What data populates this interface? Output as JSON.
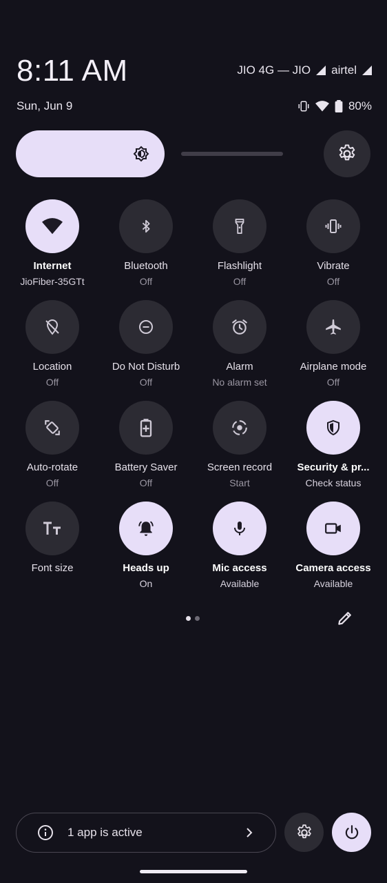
{
  "status": {
    "time": "8:11 AM",
    "carrier1": "JIO 4G — JIO",
    "carrier2": "airtel",
    "date": "Sun, Jun 9",
    "battery": "80%"
  },
  "brightness": {
    "level": 0.71
  },
  "colors": {
    "accent": "#e7def8",
    "tile_off": "#2c2b33",
    "background": "#13121b"
  },
  "tiles": [
    {
      "label": "Internet",
      "sub": "JioFiber-35GTt",
      "on": true,
      "icon": "wifi-icon"
    },
    {
      "label": "Bluetooth",
      "sub": "Off",
      "on": false,
      "icon": "bluetooth-icon"
    },
    {
      "label": "Flashlight",
      "sub": "Off",
      "on": false,
      "icon": "flashlight-icon"
    },
    {
      "label": "Vibrate",
      "sub": "Off",
      "on": false,
      "icon": "vibrate-icon"
    },
    {
      "label": "Location",
      "sub": "Off",
      "on": false,
      "icon": "location-off-icon"
    },
    {
      "label": "Do Not Disturb",
      "sub": "Off",
      "on": false,
      "icon": "do-not-disturb-icon"
    },
    {
      "label": "Alarm",
      "sub": "No alarm set",
      "on": false,
      "icon": "alarm-icon"
    },
    {
      "label": "Airplane mode",
      "sub": "Off",
      "on": false,
      "icon": "airplane-icon"
    },
    {
      "label": "Auto-rotate",
      "sub": "Off",
      "on": false,
      "icon": "auto-rotate-icon"
    },
    {
      "label": "Battery Saver",
      "sub": "Off",
      "on": false,
      "icon": "battery-saver-icon"
    },
    {
      "label": "Screen record",
      "sub": "Start",
      "on": false,
      "icon": "screen-record-icon"
    },
    {
      "label": "Security & pr...",
      "sub": "Check status",
      "on": true,
      "icon": "shield-icon"
    },
    {
      "label": "Font size",
      "sub": "",
      "on": false,
      "icon": "font-size-icon"
    },
    {
      "label": "Heads up",
      "sub": "On",
      "on": true,
      "icon": "bell-icon"
    },
    {
      "label": "Mic access",
      "sub": "Available",
      "on": true,
      "icon": "mic-icon"
    },
    {
      "label": "Camera access",
      "sub": "Available",
      "on": true,
      "icon": "camera-icon"
    }
  ],
  "pagination": {
    "pages": 2,
    "current": 1
  },
  "footer": {
    "active_apps_text": "1 app is active"
  }
}
